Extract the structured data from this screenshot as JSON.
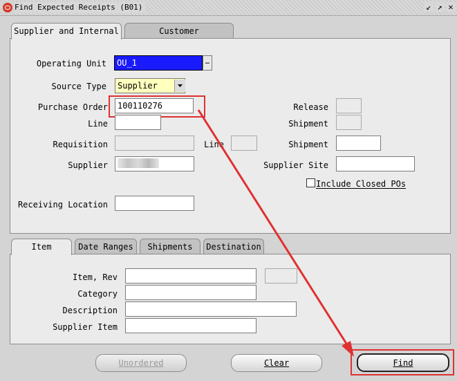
{
  "window": {
    "title": "Find Expected Receipts (B01)",
    "buttons": [
      "↙",
      "↗",
      "✕"
    ]
  },
  "top_tabs": [
    {
      "label": "Supplier and Internal",
      "active": true
    },
    {
      "label": "Customer",
      "active": false
    }
  ],
  "form": {
    "operating_unit": {
      "label": "Operating Unit",
      "value": "OU_1",
      "lov": "…"
    },
    "source_type": {
      "label": "Source Type",
      "value": "Supplier"
    },
    "purchase_order": {
      "label": "Purchase Order",
      "value": "100110276"
    },
    "release": {
      "label": "Release",
      "value": ""
    },
    "line": {
      "label": "Line",
      "value": ""
    },
    "shipment": {
      "label": "Shipment",
      "value": ""
    },
    "requisition": {
      "label": "Requisition",
      "value": ""
    },
    "req_line": {
      "label": "Line",
      "value": ""
    },
    "req_shipment": {
      "label": "Shipment",
      "value": ""
    },
    "supplier": {
      "label": "Supplier",
      "value": "t"
    },
    "supplier_site": {
      "label": "Supplier Site",
      "value": ""
    },
    "include_closed": {
      "label": "Include Closed POs",
      "checked": false
    },
    "receiving_location": {
      "label": "Receiving Location",
      "value": ""
    }
  },
  "bottom_tabs": [
    {
      "label": "Item",
      "active": true
    },
    {
      "label": "Date Ranges",
      "active": false
    },
    {
      "label": "Shipments",
      "active": false
    },
    {
      "label": "Destination",
      "active": false
    }
  ],
  "item": {
    "item_rev": {
      "label": "Item, Rev",
      "value": ""
    },
    "category": {
      "label": "Category",
      "value": ""
    },
    "description": {
      "label": "Description",
      "value": ""
    },
    "supplier_item": {
      "label": "Supplier Item",
      "value": ""
    }
  },
  "actions": {
    "unordered": "Unordered",
    "clear": "Clear",
    "find": "Find"
  },
  "colors": {
    "highlight_red": "#e03030",
    "selected_blue": "#1a1aff",
    "source_type_bg": "#ffffbe"
  }
}
